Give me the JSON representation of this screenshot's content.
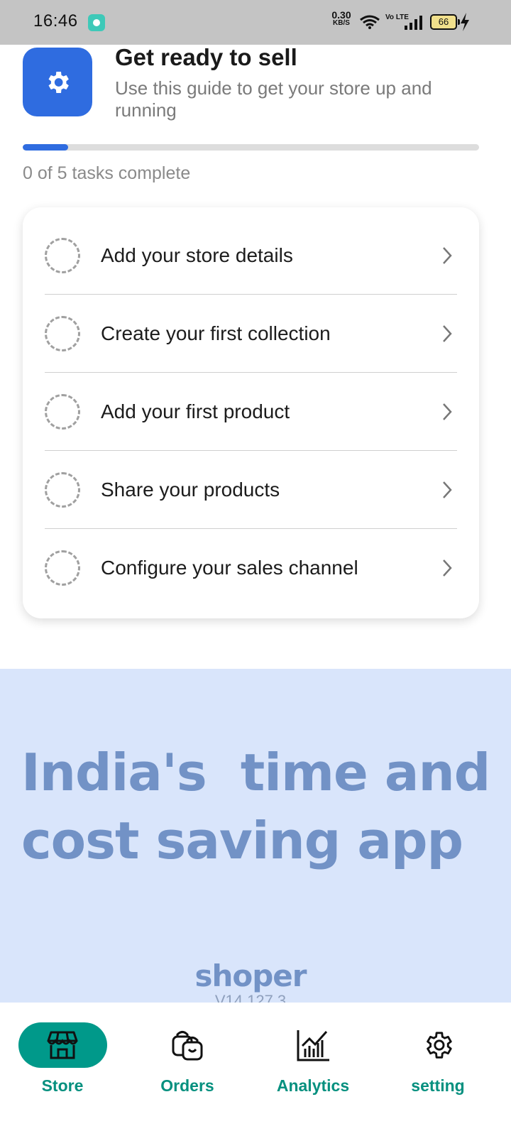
{
  "status_bar": {
    "time": "16:46",
    "net_speed_value": "0.30",
    "net_speed_unit": "KB/S",
    "volte": "Vo LTE",
    "battery": "66"
  },
  "header": {
    "title": "Get ready to sell",
    "subtitle": "Use this guide to get your store up and running",
    "progress_text": "0 of 5 tasks complete",
    "progress_fraction": 0.1
  },
  "tasks": [
    {
      "label": "Add your store details"
    },
    {
      "label": "Create your first collection"
    },
    {
      "label": "Add your first product"
    },
    {
      "label": "Share your products"
    },
    {
      "label": "Configure your sales channel"
    }
  ],
  "banner": {
    "headline": "India's  time and\ncost saving app",
    "brand": "shoper",
    "version": "V14.127.3"
  },
  "nav": {
    "items": [
      {
        "label": "Store",
        "icon": "store-icon",
        "active": true
      },
      {
        "label": "Orders",
        "icon": "orders-icon",
        "active": false
      },
      {
        "label": "Analytics",
        "icon": "analytics-icon",
        "active": false
      },
      {
        "label": "setting",
        "icon": "gear-icon",
        "active": false
      }
    ]
  },
  "colors": {
    "accent_blue": "#2f6ce0",
    "nav_teal": "#00998a",
    "banner_bg": "#d9e5fb",
    "banner_text": "#7292c6"
  }
}
